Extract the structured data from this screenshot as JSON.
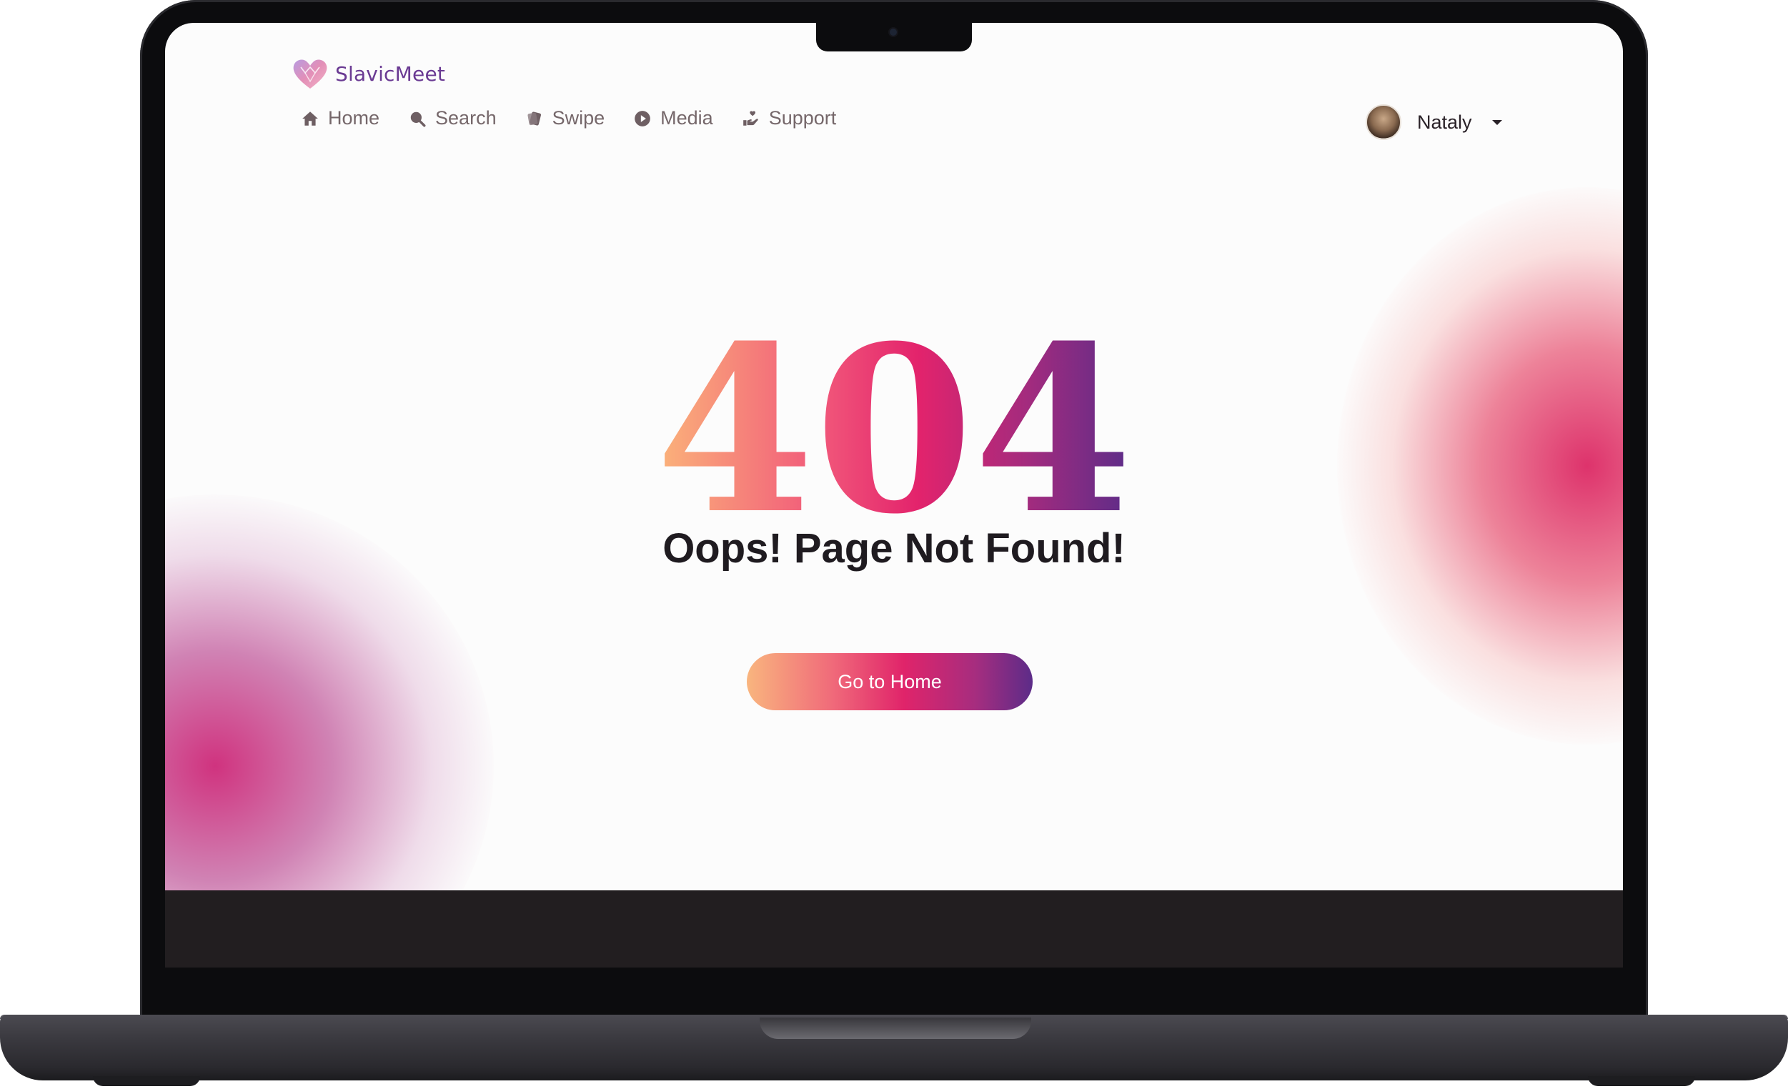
{
  "app": {
    "name": "SlavicMeet"
  },
  "nav": {
    "items": [
      {
        "label": "Home",
        "icon": "home-icon"
      },
      {
        "label": "Search",
        "icon": "search-icon"
      },
      {
        "label": "Swipe",
        "icon": "cards-icon"
      },
      {
        "label": "Media",
        "icon": "play-circle-icon"
      },
      {
        "label": "Support",
        "icon": "hand-heart-icon"
      }
    ]
  },
  "user": {
    "name": "Nataly"
  },
  "error": {
    "code": "404",
    "message": "Oops! Page Not Found!",
    "button_label": "Go to Home"
  },
  "colors": {
    "brand_purple": "#6a3a93",
    "gradient_start": "#f9b57e",
    "gradient_mid": "#e0246a",
    "gradient_end": "#5c2c88",
    "nav_text": "#75676a"
  }
}
